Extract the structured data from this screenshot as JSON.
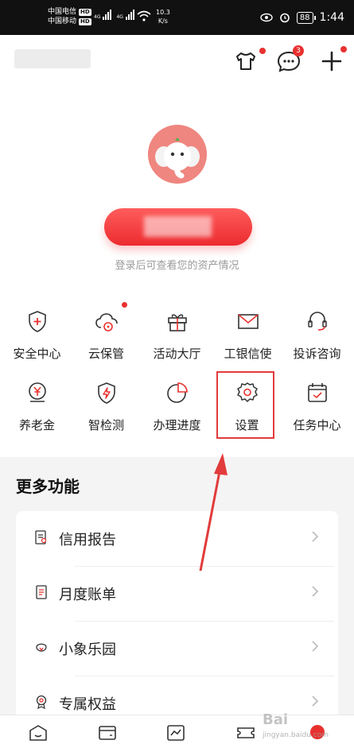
{
  "status_bar": {
    "carrier1": "中国电信",
    "carrier2": "中国移动",
    "hd": "HD",
    "net": "4G",
    "speed_value": "10.3",
    "speed_unit": "K/s",
    "battery": "88",
    "time": "1:44"
  },
  "top_actions": {
    "notifications_count": "3"
  },
  "profile": {
    "login_hint": "登录后可查看您的资产情况"
  },
  "grid": [
    {
      "label": "安全中心",
      "icon": "shield-plus-icon"
    },
    {
      "label": "云保管",
      "icon": "cloud-lock-icon"
    },
    {
      "label": "活动大厅",
      "icon": "gift-icon"
    },
    {
      "label": "工银信使",
      "icon": "envelope-icon"
    },
    {
      "label": "投诉咨询",
      "icon": "headset-icon"
    },
    {
      "label": "养老金",
      "icon": "yen-coin-icon"
    },
    {
      "label": "智检测",
      "icon": "shield-bolt-icon"
    },
    {
      "label": "办理进度",
      "icon": "pie-progress-icon"
    },
    {
      "label": "设置",
      "icon": "gear-icon"
    },
    {
      "label": "任务中心",
      "icon": "calendar-check-icon"
    }
  ],
  "more": {
    "title": "更多功能",
    "items": [
      {
        "label": "信用报告",
        "icon": "credit-report-icon"
      },
      {
        "label": "月度账单",
        "icon": "bill-icon"
      },
      {
        "label": "小象乐园",
        "icon": "elephant-icon"
      },
      {
        "label": "专属权益",
        "icon": "medal-icon"
      }
    ]
  },
  "watermark": {
    "brand": "Bai",
    "sub": "jingyan.baidu.com"
  },
  "colors": {
    "accent": "#e8312f",
    "highlight": "#e23b3b"
  }
}
